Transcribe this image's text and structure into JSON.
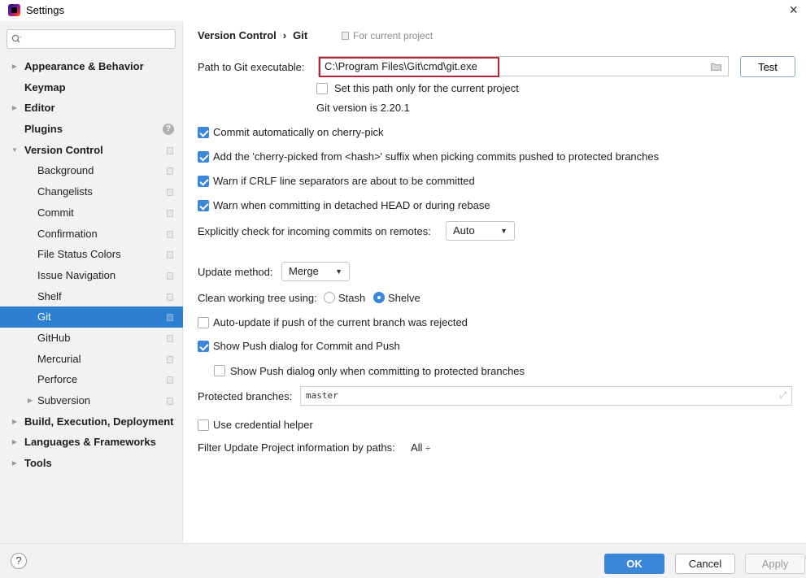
{
  "window": {
    "title": "Settings",
    "close_glyph": "×",
    "app_icon": "intellij-icon"
  },
  "search": {
    "placeholder": "",
    "value": ""
  },
  "sidebar": {
    "items": [
      {
        "label": "Appearance & Behavior",
        "bold": true,
        "arrow": "collapsed",
        "indent": 0
      },
      {
        "label": "Keymap",
        "bold": true,
        "arrow": "none",
        "indent": 0
      },
      {
        "label": "Editor",
        "bold": true,
        "arrow": "collapsed",
        "indent": 0
      },
      {
        "label": "Plugins",
        "bold": true,
        "arrow": "none",
        "indent": 0,
        "badge": "help"
      },
      {
        "label": "Version Control",
        "bold": true,
        "arrow": "expanded",
        "indent": 0,
        "page": true
      },
      {
        "label": "Background",
        "indent": 1,
        "page": true
      },
      {
        "label": "Changelists",
        "indent": 1,
        "page": true
      },
      {
        "label": "Commit",
        "indent": 1,
        "page": true
      },
      {
        "label": "Confirmation",
        "indent": 1,
        "page": true
      },
      {
        "label": "File Status Colors",
        "indent": 1,
        "page": true
      },
      {
        "label": "Issue Navigation",
        "indent": 1,
        "page": true
      },
      {
        "label": "Shelf",
        "indent": 1,
        "page": true
      },
      {
        "label": "Git",
        "indent": 1,
        "page": true,
        "selected": true
      },
      {
        "label": "GitHub",
        "indent": 1,
        "page": true
      },
      {
        "label": "Mercurial",
        "indent": 1,
        "page": true
      },
      {
        "label": "Perforce",
        "indent": 1,
        "page": true
      },
      {
        "label": "Subversion",
        "indent": 1,
        "arrow": "collapsed",
        "page": true
      },
      {
        "label": "Build, Execution, Deployment",
        "bold": true,
        "arrow": "collapsed",
        "indent": 0
      },
      {
        "label": "Languages & Frameworks",
        "bold": true,
        "arrow": "collapsed",
        "indent": 0
      },
      {
        "label": "Tools",
        "bold": true,
        "arrow": "collapsed",
        "indent": 0
      }
    ]
  },
  "breadcrumb": {
    "parent": "Version Control",
    "separator": "›",
    "current": "Git",
    "scope": "For current project"
  },
  "git": {
    "path_label": "Path to Git executable:",
    "path_value": "C:\\Program Files\\Git\\cmd\\git.exe",
    "test_label": "Test",
    "current_project_only_label": "Set this path only for the current project",
    "current_project_only": false,
    "version_text": "Git version is 2.20.1",
    "checks": [
      {
        "label": "Commit automatically on cherry-pick",
        "checked": true
      },
      {
        "label": "Add the 'cherry-picked from <hash>' suffix when picking commits pushed to protected branches",
        "checked": true
      },
      {
        "label": "Warn if CRLF line separators are about to be committed",
        "checked": true
      },
      {
        "label": "Warn when committing in detached HEAD or during rebase",
        "checked": true
      }
    ],
    "incoming_label": "Explicitly check for incoming commits on remotes:",
    "incoming_value": "Auto",
    "update_label": "Update method:",
    "update_value": "Merge",
    "clean_label": "Clean working tree using:",
    "clean_options": [
      {
        "label": "Stash",
        "selected": false
      },
      {
        "label": "Shelve",
        "selected": true
      }
    ],
    "auto_update_label": "Auto-update if push of the current branch was rejected",
    "auto_update": false,
    "show_push_label": "Show Push dialog for Commit and Push",
    "show_push": true,
    "push_protected_label": "Show Push dialog only when committing to protected branches",
    "push_protected": false,
    "protected_label": "Protected branches:",
    "protected_value": "master",
    "credential_label": "Use credential helper",
    "credential": false,
    "filter_label": "Filter Update Project information by paths:",
    "filter_value": "All",
    "filter_glyph": "÷"
  },
  "footer": {
    "help": "?",
    "ok": "OK",
    "cancel": "Cancel",
    "apply": "Apply"
  },
  "colors": {
    "accent": "#3b86d8",
    "selection": "#2d7fd0",
    "highlight_border": "#b3263a"
  }
}
